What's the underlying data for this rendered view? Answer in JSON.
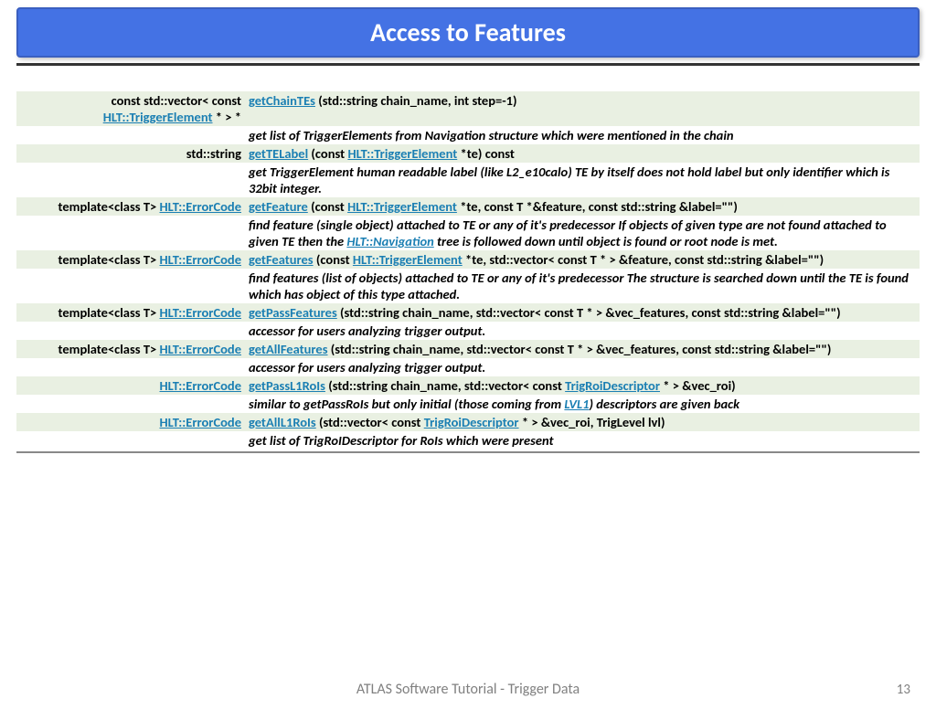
{
  "title": "Access to Features",
  "footer": "ATLAS Software Tutorial - Trigger Data",
  "page": "13",
  "links": {
    "trigElem": "HLT::TriggerElement",
    "errCode": "HLT::ErrorCode",
    "nav": "HLT::Navigation",
    "trd": "TrigRoiDescriptor",
    "lvl1": "LVL1"
  },
  "rows": [
    {
      "ret_pre": "const std::vector< const ",
      "ret_link": "trigElem",
      "ret_post": " * > *",
      "fn": "getChainTEs",
      "sig": " (std::string chain_name, int step=-1)",
      "desc_parts": [
        [
          "t",
          "get list of TriggerElements from Navigation structure which were mentioned in the chain"
        ]
      ]
    },
    {
      "ret_pre": "std::string",
      "fn": "getTELabel",
      "sig_parts": [
        [
          "t",
          " (const "
        ],
        [
          "l",
          "trigElem"
        ],
        [
          "t",
          " *te) const"
        ]
      ],
      "desc_parts": [
        [
          "t",
          "get TriggerElement human readable label (like L2_e10calo) TE by itself does not hold label but only identifier which is 32bit integer."
        ]
      ]
    },
    {
      "ret_pre": "template<class T> ",
      "ret_link": "errCode",
      "fn": "getFeature",
      "sig_parts": [
        [
          "t",
          " (const "
        ],
        [
          "l",
          "trigElem"
        ],
        [
          "t",
          " *te, const T *&feature, const std::string &label=\"\")"
        ]
      ],
      "desc_parts": [
        [
          "t",
          "find feature (single object) attached to TE or any of it's predecessor If objects of given type are not found attached to given TE then the "
        ],
        [
          "l",
          "nav"
        ],
        [
          "t",
          " tree is followed down until object is found or root node is met."
        ]
      ]
    },
    {
      "ret_pre": "template<class T> ",
      "ret_link": "errCode",
      "fn": "getFeatures",
      "sig_parts": [
        [
          "t",
          " (const "
        ],
        [
          "l",
          "trigElem"
        ],
        [
          "t",
          " *te, std::vector< const T * > &feature, const std::string &label=\"\")"
        ]
      ],
      "desc_parts": [
        [
          "t",
          "find features (list of objects) attached to TE or any of it's predecessor The structure is searched down until the TE is found which has object of this type attached."
        ]
      ]
    },
    {
      "ret_pre": "template<class T> ",
      "ret_link": "errCode",
      "fn": "getPassFeatures",
      "sig": " (std::string chain_name, std::vector< const T * > &vec_features, const std::string &label=\"\")",
      "desc_parts": [
        [
          "t",
          "accessor for users analyzing trigger output."
        ]
      ]
    },
    {
      "ret_pre": "template<class T> ",
      "ret_link": "errCode",
      "fn": "getAllFeatures",
      "sig": " (std::string chain_name, std::vector< const T * > &vec_features, const std::string &label=\"\")",
      "desc_parts": [
        [
          "t",
          "accessor for users analyzing trigger output."
        ]
      ]
    },
    {
      "ret_link": "errCode",
      "fn": "getPassL1RoIs",
      "sig_parts": [
        [
          "t",
          " (std::string chain_name, std::vector< const "
        ],
        [
          "l",
          "trd"
        ],
        [
          "t",
          " * > &vec_roi)"
        ]
      ],
      "desc_parts": [
        [
          "t",
          "similar to getPassRoIs but only initial (those coming from "
        ],
        [
          "l",
          "lvl1"
        ],
        [
          "t",
          ") descriptors are given back"
        ]
      ]
    },
    {
      "ret_link": "errCode",
      "fn": "getAllL1RoIs",
      "sig_parts": [
        [
          "t",
          " (std::vector< const "
        ],
        [
          "l",
          "trd"
        ],
        [
          "t",
          " * > &vec_roi, TrigLevel lvl)"
        ]
      ],
      "desc_parts": [
        [
          "t",
          "get list of TrigRoIDescriptor for RoIs which were present"
        ]
      ]
    }
  ]
}
